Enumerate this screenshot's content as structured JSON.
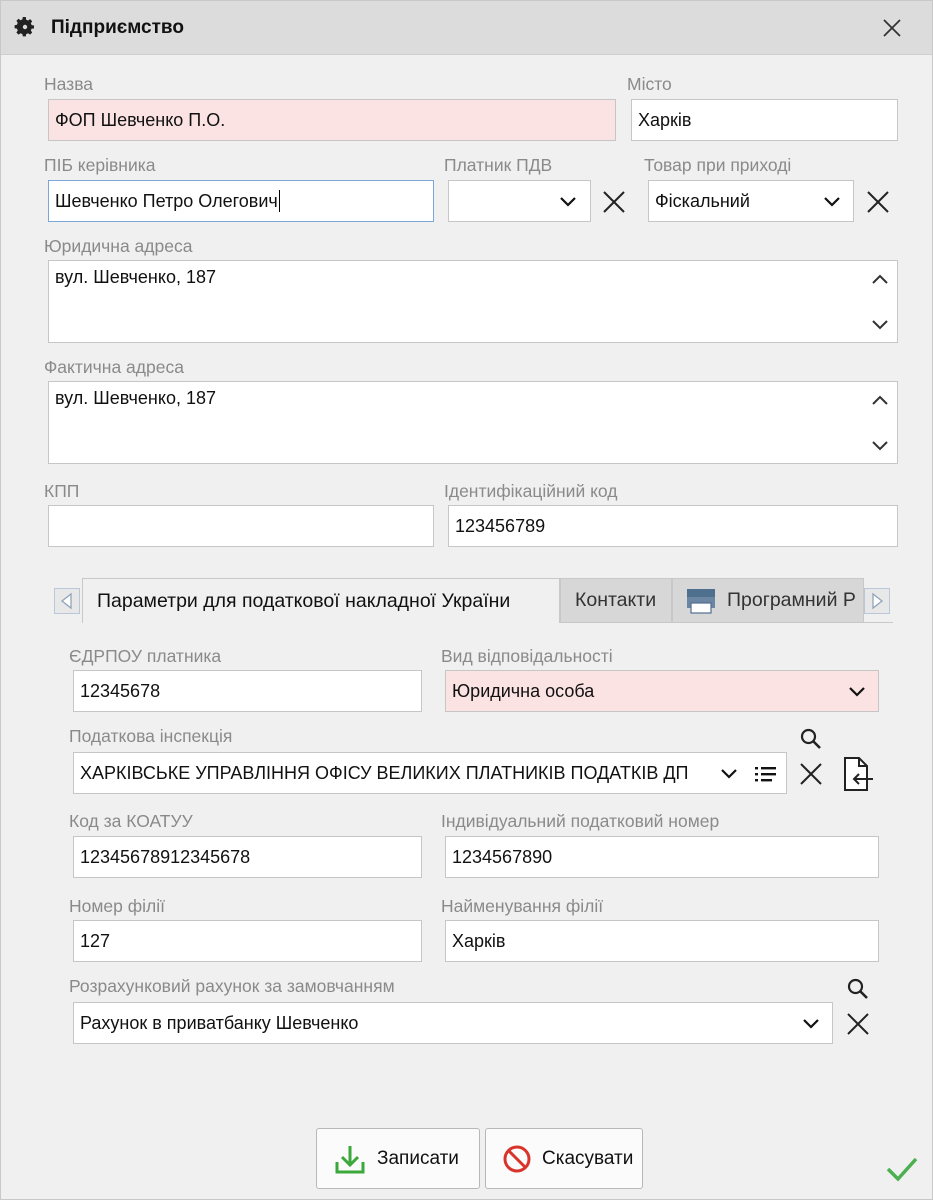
{
  "window": {
    "title": "Підприємство"
  },
  "labels": {
    "name": "Назва",
    "city": "Місто",
    "director": "ПІБ керівника",
    "vat_payer": "Платник ПДВ",
    "goods_on_receipt": "Товар при приході",
    "legal_address": "Юридична адреса",
    "actual_address": "Фактична адреса",
    "kpp": "КПП",
    "id_code": "Ідентифікаційний код"
  },
  "values": {
    "name": "ФОП Шевченко П.О.",
    "city": "Харків",
    "director": "Шевченко Петро Олегович",
    "vat_payer": "",
    "goods_on_receipt": "Фіскальний",
    "legal_address": "вул. Шевченко, 187",
    "actual_address": "вул. Шевченко, 187",
    "kpp": "",
    "id_code": "123456789"
  },
  "tabs": [
    {
      "label": "Параметри для податкової накладної України"
    },
    {
      "label": "Контакти"
    },
    {
      "label": "Програмний Р"
    }
  ],
  "tax": {
    "labels": {
      "edrpou": "ЄДРПОУ платника",
      "responsibility": "Вид відповідальності",
      "inspection": "Податкова інспекція",
      "koatuu": "Код за КОАТУУ",
      "itn": "Індивідуальний податковий номер",
      "branch_no": "Номер філії",
      "branch_name": "Найменування філії",
      "account": "Розрахунковий рахунок за замовчанням"
    },
    "values": {
      "edrpou": "12345678",
      "responsibility": "Юридична особа",
      "inspection": "ХАРКІВСЬКЕ  УПРАВЛІННЯ ОФІСУ ВЕЛИКИХ ПЛАТНИКІВ ПОДАТКІВ ДП",
      "koatuu": "12345678912345678",
      "itn": "1234567890",
      "branch_no": "127",
      "branch_name": "Харків",
      "account": "Рахунок в приватбанку Шевченко"
    }
  },
  "buttons": {
    "save": "Записати",
    "cancel": "Скасувати"
  },
  "colors": {
    "required_bg": "#fbe3e3",
    "save_icon": "#3aa83a",
    "cancel_icon": "#d9342b",
    "check": "#4caf50"
  }
}
